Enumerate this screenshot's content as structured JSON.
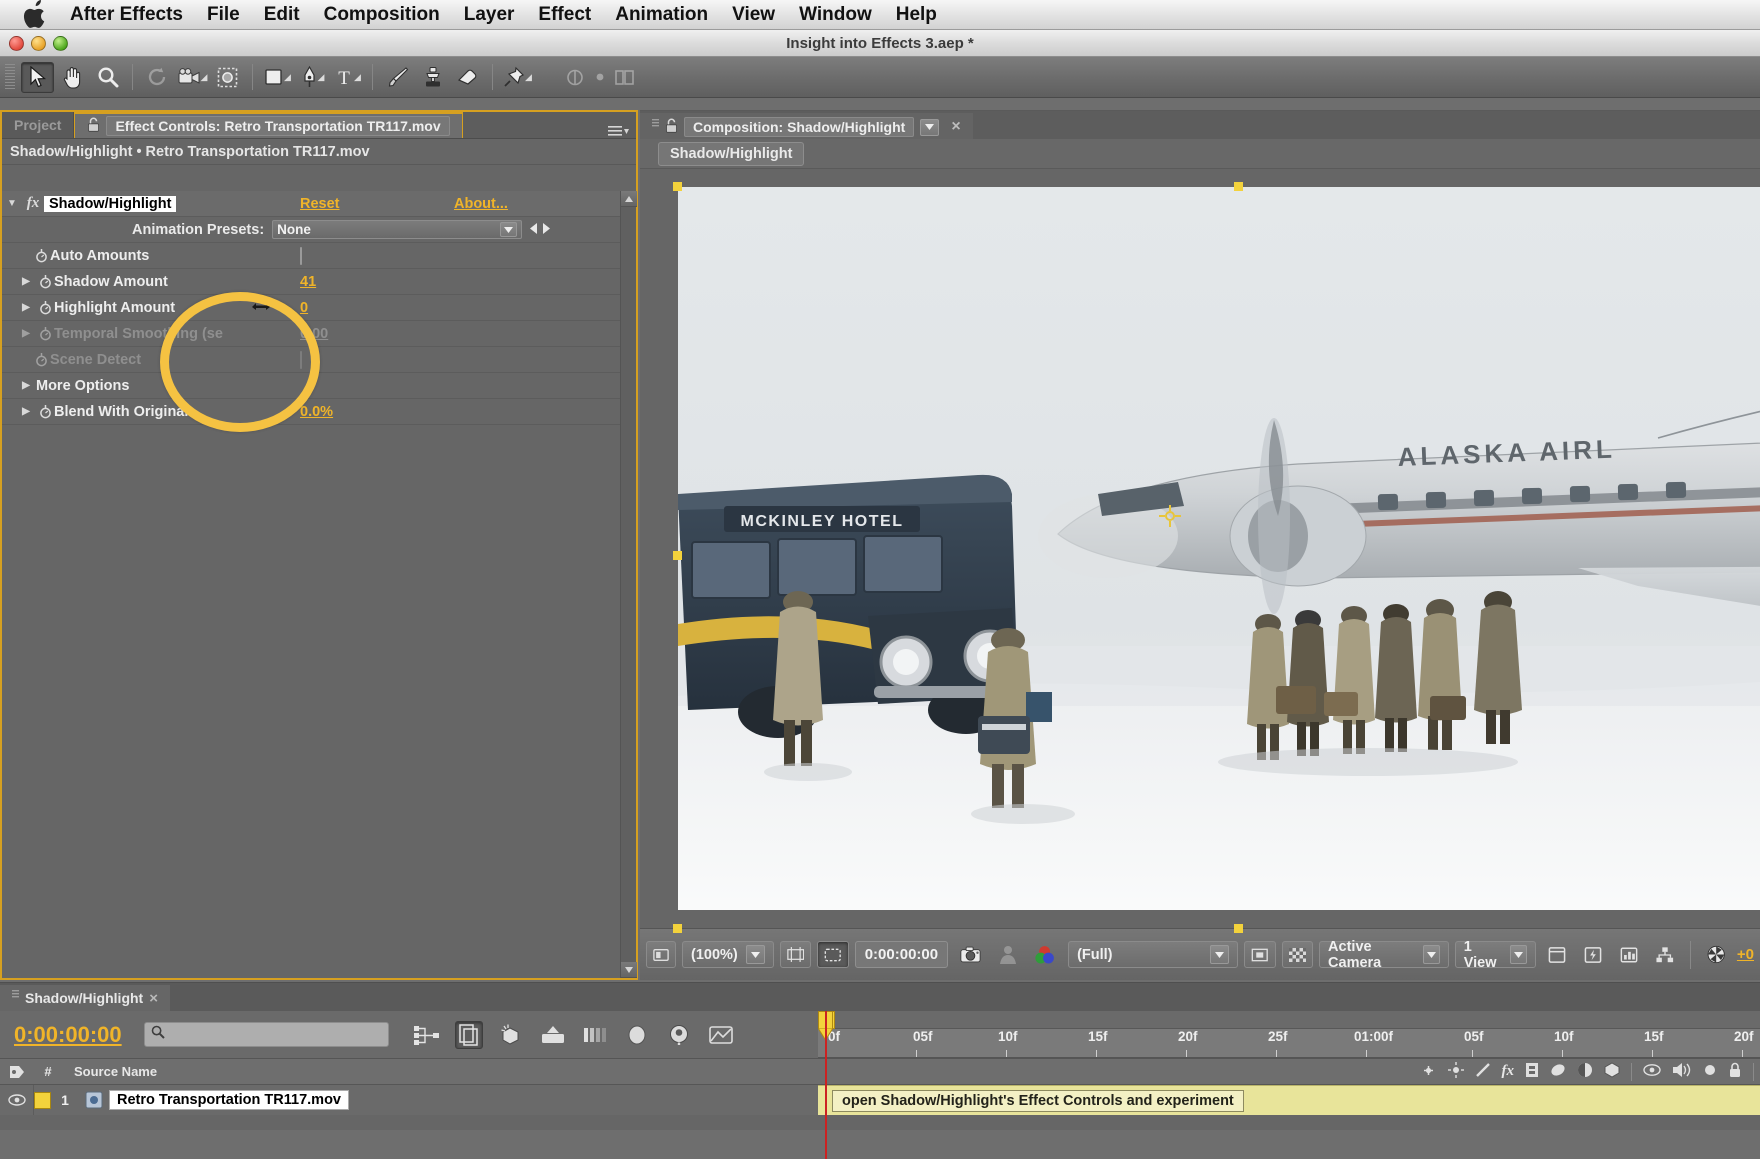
{
  "menubar": {
    "apple_icon": "apple-logo-icon",
    "items": [
      "After Effects",
      "File",
      "Edit",
      "Composition",
      "Layer",
      "Effect",
      "Animation",
      "View",
      "Window",
      "Help"
    ]
  },
  "titlebar": {
    "document_title": "Insight into Effects 3.aep *"
  },
  "toolbar": {
    "tools": [
      {
        "name": "selection-tool",
        "icon": "arrow-icon",
        "active": true
      },
      {
        "name": "hand-tool",
        "icon": "hand-icon",
        "active": false
      },
      {
        "name": "zoom-tool",
        "icon": "magnifier-icon",
        "active": false
      },
      {
        "name": "rotation-tool",
        "icon": "rotate-icon",
        "active": false
      },
      {
        "name": "camera-tool",
        "icon": "camera-icon",
        "active": false
      },
      {
        "name": "pan-behind-tool",
        "icon": "anchor-point-icon",
        "active": false
      },
      {
        "name": "shape-tool",
        "icon": "rectangle-icon",
        "active": false
      },
      {
        "name": "pen-tool",
        "icon": "pen-icon",
        "active": false
      },
      {
        "name": "type-tool",
        "icon": "text-t-icon",
        "active": false
      },
      {
        "name": "brush-tool",
        "icon": "paintbrush-icon",
        "active": false
      },
      {
        "name": "clone-stamp-tool",
        "icon": "clone-stamp-icon",
        "active": false
      },
      {
        "name": "eraser-tool",
        "icon": "eraser-icon",
        "active": false
      },
      {
        "name": "puppet-pin-tool",
        "icon": "pushpin-icon",
        "active": false
      }
    ]
  },
  "effect_controls": {
    "tabs": [
      {
        "label": "Project",
        "active": false
      },
      {
        "label": "Effect Controls: Retro Transportation TR117.mov",
        "active": true
      }
    ],
    "subheader": "Shadow/Highlight • Retro Transportation TR117.mov",
    "effect_name": "Shadow/Highlight",
    "reset_label": "Reset",
    "about_label": "About...",
    "animation_presets_label": "Animation Presets:",
    "animation_presets_value": "None",
    "properties": [
      {
        "label": "Auto Amounts",
        "value": "",
        "type": "checkbox",
        "checked": false,
        "enabled": true,
        "twirl": false,
        "stopwatch": true
      },
      {
        "label": "Shadow Amount",
        "value": "41",
        "type": "number",
        "enabled": true,
        "twirl": true,
        "stopwatch": true
      },
      {
        "label": "Highlight Amount",
        "value": "0",
        "type": "number",
        "enabled": true,
        "twirl": true,
        "stopwatch": true
      },
      {
        "label": "Temporal Smoothing (se",
        "value": "0.00",
        "type": "number",
        "enabled": false,
        "twirl": true,
        "stopwatch": true
      },
      {
        "label": "Scene Detect",
        "value": "",
        "type": "checkbox",
        "checked": false,
        "enabled": false,
        "twirl": false,
        "stopwatch": true
      },
      {
        "label": "More Options",
        "value": "",
        "type": "group",
        "enabled": true,
        "twirl": true,
        "stopwatch": false
      },
      {
        "label": "Blend With Original",
        "value": "0.0%",
        "type": "number",
        "enabled": true,
        "twirl": true,
        "stopwatch": true
      }
    ],
    "callout": {
      "shape": "circle",
      "color": "#f5c242"
    }
  },
  "composition": {
    "tab_label": "Composition: Shadow/Highlight",
    "close_label": "×",
    "sub_tab_label": "Shadow/Highlight",
    "toolbar": {
      "zoom_value": "(100%)",
      "time_value": "0:00:00:00",
      "resolution_value": "(Full)",
      "camera_value": "Active Camera",
      "view_value": "1 View",
      "exposure_value": "+0"
    }
  },
  "timeline": {
    "tab_label": "Shadow/Highlight",
    "tab_close": "×",
    "current_time": "0:00:00:00",
    "search_placeholder": "",
    "columns": {
      "hash": "#",
      "source_name": "Source Name"
    },
    "ruler_ticks": [
      "0f",
      "05f",
      "10f",
      "15f",
      "20f",
      "25f",
      "01:00f",
      "05f",
      "10f",
      "15f",
      "20f"
    ],
    "layers": [
      {
        "index": "1",
        "source_name": "Retro Transportation TR117.mov",
        "has_fx": true
      }
    ],
    "tooltip": "open Shadow/Highlight's Effect Controls and experiment"
  },
  "colors": {
    "accent_yellow": "#f0b429",
    "callout_yellow": "#f5c242",
    "panel_bg": "#666666",
    "toolbar_bg": "#6e6e6e",
    "playhead_red": "#cc2222",
    "work_area_green": "#3ea832"
  }
}
